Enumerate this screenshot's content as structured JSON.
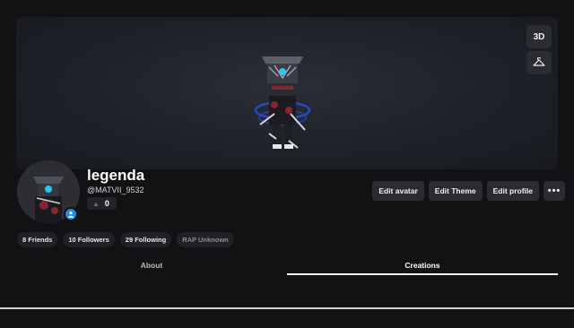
{
  "banner": {
    "view_3d_label": "3D",
    "hanger_icon": "hanger-icon",
    "avatar_image": "avatar-3d-render"
  },
  "profile": {
    "display_name": "legenda",
    "username": "@MATVII_9532",
    "score": "0",
    "badge_icon": "user-badge-icon",
    "accent_color": "#1e8bf0"
  },
  "actions": {
    "edit_avatar": "Edit avatar",
    "edit_theme": "Edit Theme",
    "edit_profile": "Edit profile",
    "more": "•••"
  },
  "stats": [
    {
      "label": "8 Friends"
    },
    {
      "label": "10 Followers"
    },
    {
      "label": "29 Following"
    },
    {
      "label": "RAP Unknown"
    }
  ],
  "tabs": [
    {
      "label": "About",
      "active": false
    },
    {
      "label": "Creations",
      "active": true
    }
  ]
}
